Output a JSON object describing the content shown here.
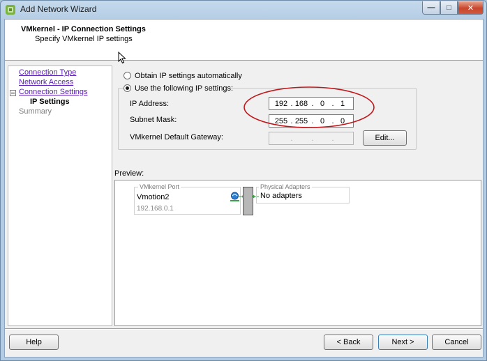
{
  "window": {
    "title": "Add Network Wizard"
  },
  "header": {
    "title": "VMkernel - IP Connection Settings",
    "subtitle": "Specify VMkernel IP settings"
  },
  "nav": {
    "items": [
      {
        "label": "Connection Type"
      },
      {
        "label": "Network Access"
      },
      {
        "label": "Connection Settings"
      },
      {
        "label": "IP Settings"
      },
      {
        "label": "Summary"
      }
    ]
  },
  "ip_settings": {
    "obtain_auto_label": "Obtain IP settings automatically",
    "use_following_label": "Use the following IP settings:",
    "selected_option": "use_following",
    "ip_address_label": "IP Address:",
    "ip_address": [
      "192",
      "168",
      "0",
      "1"
    ],
    "subnet_mask_label": "Subnet Mask:",
    "subnet_mask": [
      "255",
      "255",
      "0",
      "0"
    ],
    "gateway_label": "VMkernel Default Gateway:",
    "gateway_separator": ".",
    "edit_button": "Edit..."
  },
  "preview": {
    "label": "Preview:",
    "vmkernel_port_title": "VMkernel Port",
    "port_name": "Vmotion2",
    "port_ip": "192.168.0.1",
    "physical_adapters_title": "Physical Adapters",
    "physical_adapters_value": "No adapters"
  },
  "footer": {
    "help": "Help",
    "back": "< Back",
    "next": "Next >",
    "cancel": "Cancel"
  },
  "colors": {
    "annotation_ellipse": "#c0171b",
    "link": "#5a1fb5"
  },
  "icons": {
    "app": "vsphere-logo-icon",
    "port": "network-port-icon"
  }
}
